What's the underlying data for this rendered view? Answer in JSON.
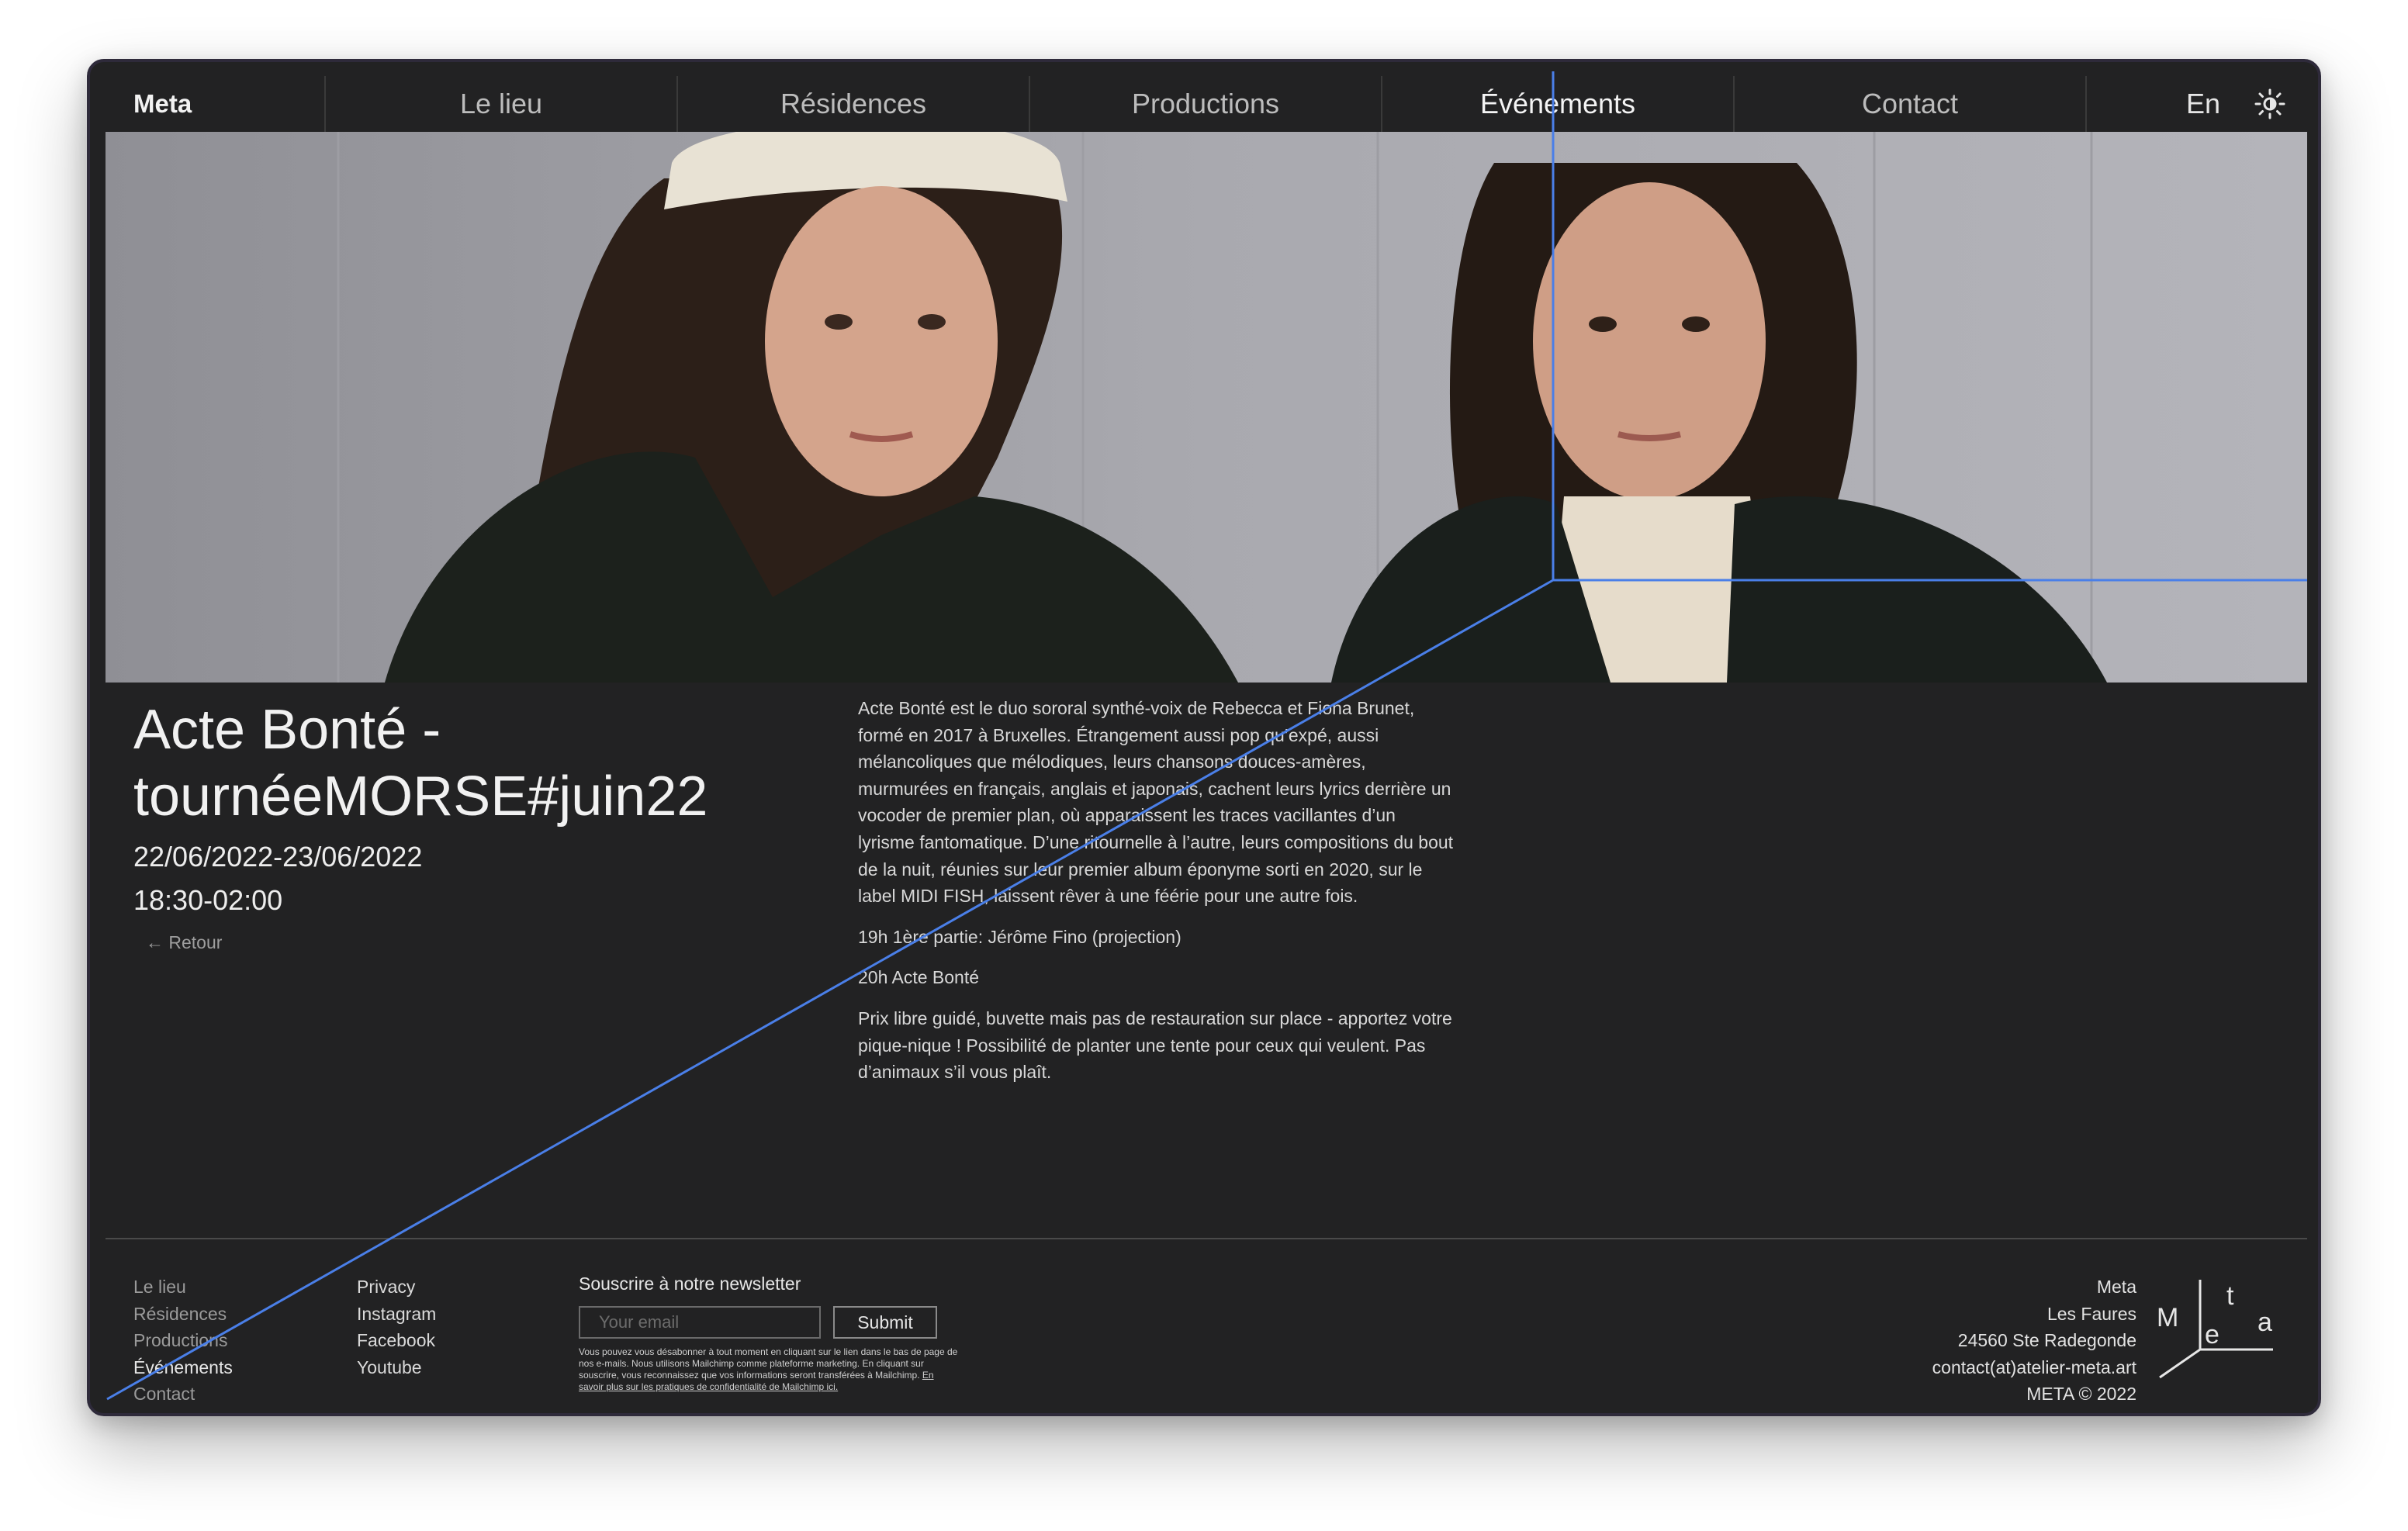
{
  "nav": {
    "brand": "Meta",
    "items": [
      "Le lieu",
      "Résidences",
      "Productions",
      "Événements",
      "Contact"
    ],
    "lang": "En",
    "theme_icon": "sun-icon"
  },
  "event": {
    "title": "Acte Bonté - tournéeMORSE#juin22",
    "dates": "22/06/2022-23/06/2022",
    "time": "18:30-02:00",
    "back": "← Retour",
    "paragraphs": [
      "Acte Bonté est le duo sororal synthé-voix de Rebecca et Fiona Brunet, formé en 2017 à Bruxelles. Étrangement aussi pop qu’expé, aussi mélancoliques que mélodiques, leurs chansons douces-amères, murmurées en français, anglais et japonais, cachent leurs lyrics derrière un vocoder de premier plan, où apparaissent les traces vacillantes d’un lyrisme fantomatique. D’une ritournelle à l’autre, leurs compositions du bout de la nuit, réunies sur leur premier album éponyme sorti en 2020, sur le label MIDI FISH, laissent rêver à une féérie pour une autre fois.",
      "19h 1ère partie: Jérôme Fino (projection)",
      "20h Acte Bonté",
      "Prix libre guidé, buvette mais pas de restauration sur place - apportez votre pique-nique ! Possibilité de planter une tente pour ceux qui veulent. Pas d’animaux s’il vous plaît."
    ]
  },
  "footer": {
    "nav_links": [
      "Le lieu",
      "Résidences",
      "Productions",
      "Événements",
      "Contact"
    ],
    "social_links": [
      "Privacy",
      "Instagram",
      "Facebook",
      "Youtube"
    ],
    "newsletter": {
      "title": "Souscrire à notre newsletter",
      "placeholder": "Your email",
      "submit": "Submit",
      "legal": "Vous pouvez vous désabonner à tout moment en cliquant sur le lien dans le bas de page de nos e-mails. Nous utilisons Mailchimp comme plateforme marketing. En cliquant sur souscrire, vous reconnaissez que vos informations seront transférées à Mailchimp.",
      "legal_link": "En savoir plus sur les pratiques de confidentialité de Mailchimp ici."
    },
    "address": [
      "Meta",
      "Les Faures",
      "24560 Ste Radegonde",
      "contact(at)atelier-meta.art",
      "META © 2022"
    ],
    "logo_letters": [
      "M",
      "e",
      "t",
      "a"
    ]
  },
  "colors": {
    "background": "#222223",
    "accent_line": "#4a7fe8",
    "text": "#e6e6e6",
    "muted": "#9a9a9a"
  }
}
